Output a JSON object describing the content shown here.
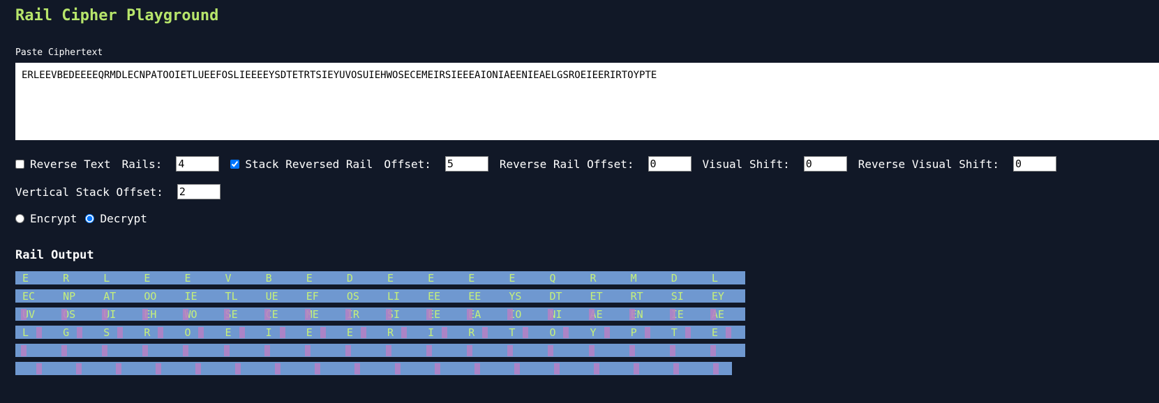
{
  "title": "Rail Cipher Playground",
  "paste_label": "Paste Ciphertext",
  "ciphertext": "ERLEEVBEDEEEEQRMDLECNPATOOIETLUEEFOSLIEEEEYSDTETRTSIEYUVOSUIEHWOSECEMEIRSIEEEAIONIAEENIEAELGSROEIEERIRTOYPTE",
  "controls": {
    "reverse_text_label": "Reverse Text",
    "reverse_text_checked": false,
    "rails_label": "Rails:",
    "rails_value": "4",
    "stack_reversed_label": "Stack Reversed Rail",
    "stack_reversed_checked": true,
    "offset_label": "Offset:",
    "offset_value": "5",
    "reverse_rail_offset_label": "Reverse Rail Offset:",
    "reverse_rail_offset_value": "0",
    "visual_shift_label": "Visual Shift:",
    "visual_shift_value": "0",
    "reverse_visual_shift_label": "Reverse Visual Shift:",
    "reverse_visual_shift_value": "0",
    "vertical_stack_offset_label": "Vertical Stack Offset:",
    "vertical_stack_offset_value": "2",
    "mode_encrypt_label": "Encrypt",
    "mode_decrypt_label": "Decrypt",
    "mode_selected": "Decrypt"
  },
  "output_heading": "Rail Output",
  "rails": [
    "E R L E E V B E D E E E E Q R M D L",
    "EC NP AT OO IE TL UE EF OS LI EE EE YS DT ET RT SI EY",
    "UV OS UI EH WO SE CE ME IR SI EE EA IO NI AE EN IE AE",
    "L G S R O E I E E R I R T O Y P T E",
    "",
    ""
  ],
  "colors": {
    "background": "#111827",
    "title": "#b7e56b",
    "rail_band": "#6f98d0",
    "rail_letter": "#c6f07a",
    "rail_marker": "#b680c4"
  }
}
